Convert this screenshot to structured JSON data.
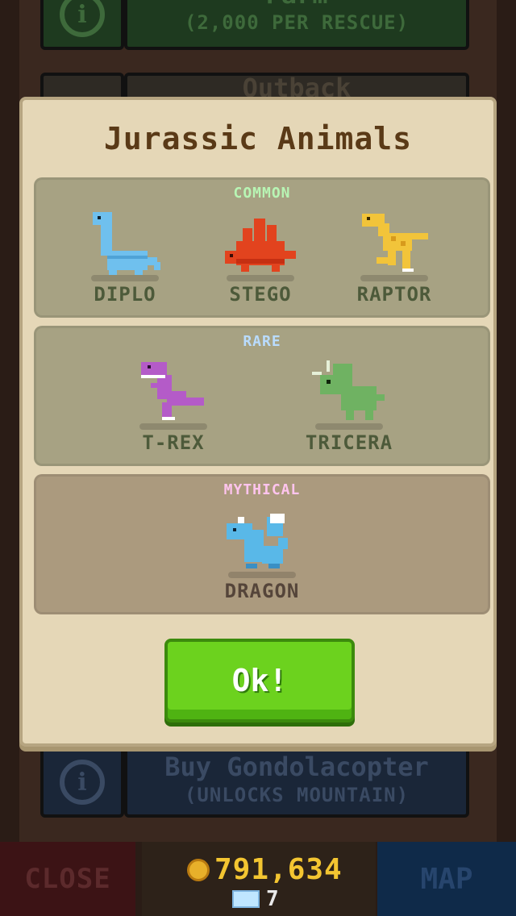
{
  "background": {
    "rows": [
      {
        "title": "Farm",
        "subtitle": "(2,000 PER RESCUE)"
      },
      {
        "title": "Outback"
      },
      {
        "title": "Buy Gondolacopter",
        "subtitle": "(UNLOCKS MOUNTAIN)"
      }
    ],
    "info_icon": "info-icon"
  },
  "modal": {
    "title": "Jurassic Animals",
    "ok_label": "Ok!",
    "sections": {
      "common": {
        "title": "COMMON",
        "animals": [
          {
            "name": "DIPLO",
            "color": "#6fc0ee"
          },
          {
            "name": "STEGO",
            "color": "#e2431e"
          },
          {
            "name": "RAPTOR",
            "color": "#f2c43a"
          }
        ]
      },
      "rare": {
        "title": "RARE",
        "animals": [
          {
            "name": "T-REX",
            "color": "#b45bc8"
          },
          {
            "name": "TRICERA",
            "color": "#6fb262"
          }
        ]
      },
      "mythical": {
        "title": "MYTHICAL",
        "animals": [
          {
            "name": "DRAGON",
            "color": "#59b8e8"
          }
        ]
      }
    }
  },
  "bottom_bar": {
    "close_label": "CLOSE",
    "map_label": "MAP",
    "coins": "791,634",
    "gems": "7"
  }
}
